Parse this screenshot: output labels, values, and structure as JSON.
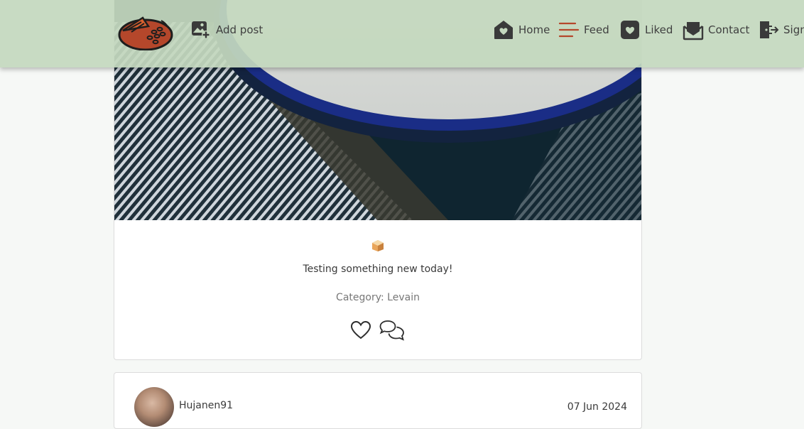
{
  "nav": {
    "add_post": "Add post",
    "home": "Home",
    "feed": "Feed",
    "liked": "Liked",
    "contact": "Contact",
    "sign": "Sign"
  },
  "post": {
    "caption": "Testing something new today!",
    "category_label": "Category:",
    "category_value": "Levain"
  },
  "next_post": {
    "author": "Hujanen91",
    "date": "07 Jun 2024"
  },
  "colors": {
    "navbar": "#c4d8be",
    "accent": "#b5472b",
    "background": "#f6f8f6"
  },
  "icons": [
    "logo-icon",
    "add-photo-icon",
    "home-icon",
    "feed-icon",
    "liked-icon",
    "contact-icon",
    "sign-in-icon",
    "bread-icon",
    "heart-icon",
    "comment-icon"
  ]
}
